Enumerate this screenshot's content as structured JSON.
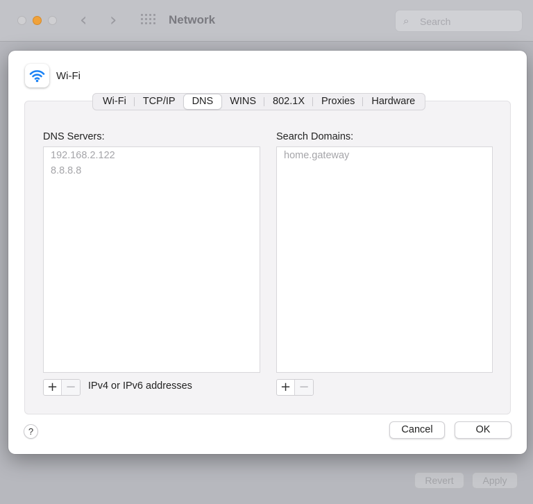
{
  "window": {
    "title": "Network",
    "search_placeholder": "Search",
    "revert_label": "Revert",
    "apply_label": "Apply"
  },
  "sheet": {
    "title": "Wi-Fi",
    "tabs": [
      {
        "label": "Wi-Fi",
        "active": false
      },
      {
        "label": "TCP/IP",
        "active": false
      },
      {
        "label": "DNS",
        "active": true
      },
      {
        "label": "WINS",
        "active": false
      },
      {
        "label": "802.1X",
        "active": false
      },
      {
        "label": "Proxies",
        "active": false
      },
      {
        "label": "Hardware",
        "active": false
      }
    ],
    "dns": {
      "label": "DNS Servers:",
      "items": [
        "192.168.2.122",
        "8.8.8.8"
      ],
      "hint": "IPv4 or IPv6 addresses"
    },
    "search_domains": {
      "label": "Search Domains:",
      "items": [
        "home.gateway"
      ]
    },
    "help_label": "?",
    "cancel_label": "Cancel",
    "ok_label": "OK"
  },
  "controls": {
    "plus": "+",
    "minus": "−"
  },
  "icons": {
    "wifi": "wifi-icon",
    "search": "magnifier-icon",
    "back": "chevron-left-icon",
    "forward": "chevron-right-icon",
    "grid": "grid-icon"
  },
  "colors": {
    "accent": "#1a82f5",
    "minimize": "#f0a23a"
  }
}
